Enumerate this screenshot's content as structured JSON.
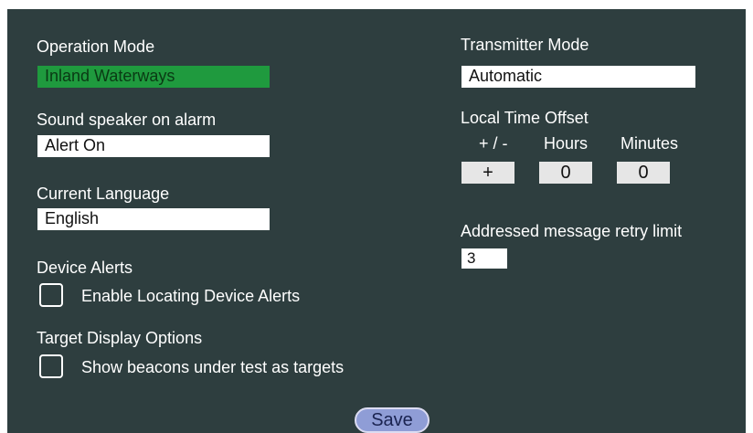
{
  "operation_mode": {
    "label": "Operation Mode",
    "value": "Inland Waterways",
    "value_color": "#1f9a3e"
  },
  "sound_speaker": {
    "label": "Sound speaker on alarm",
    "value": "Alert On"
  },
  "current_language": {
    "label": "Current Language",
    "value": "English"
  },
  "device_alerts": {
    "label": "Device Alerts",
    "checkbox_label": "Enable Locating Device Alerts",
    "checked": false
  },
  "target_display": {
    "label": "Target Display Options",
    "checkbox_label": "Show beacons under test as targets",
    "checked": false
  },
  "transmitter_mode": {
    "label": "Transmitter Mode",
    "value": "Automatic"
  },
  "local_time_offset": {
    "label": "Local Time Offset",
    "sign_header": "+ / -",
    "hours_header": "Hours",
    "minutes_header": "Minutes",
    "sign": "+",
    "hours": "0",
    "minutes": "0"
  },
  "retry_limit": {
    "label": "Addressed message retry limit",
    "value": "3"
  },
  "save_label": "Save",
  "colors": {
    "panel_background": "#2e3e3f",
    "save_button": "#8f9dd6"
  }
}
